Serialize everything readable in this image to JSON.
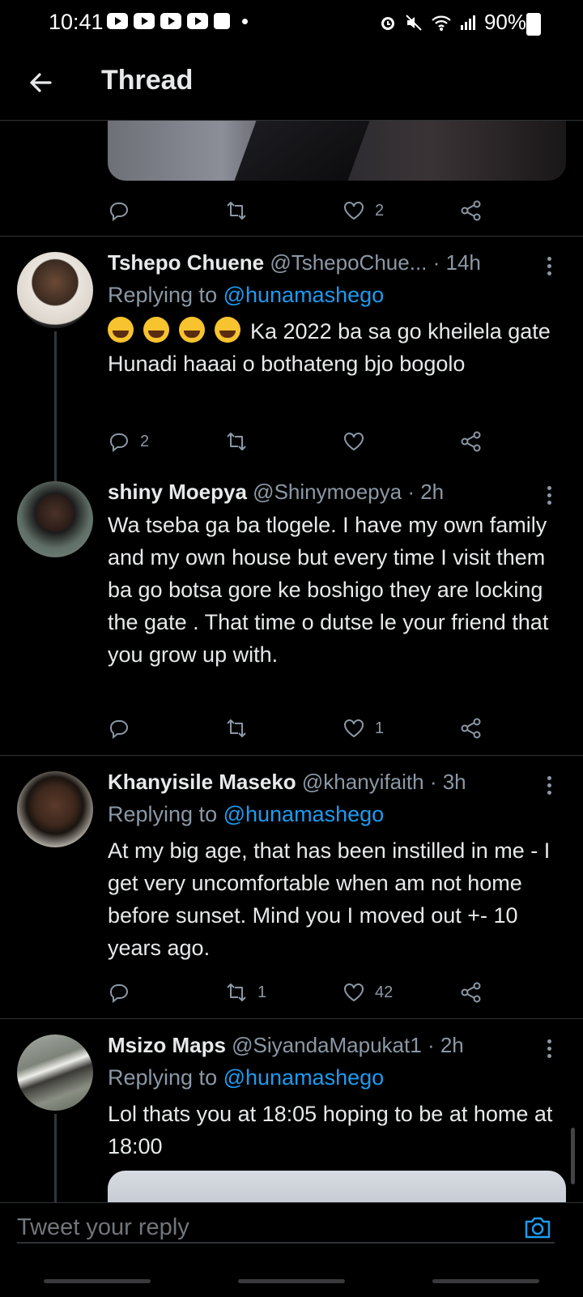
{
  "status_bar": {
    "time": "10:41",
    "battery": "90%"
  },
  "header": {
    "title": "Thread"
  },
  "first_tweet_actions": {
    "likes": "2"
  },
  "tweets": [
    {
      "name": "Tshepo Chuene",
      "handle": "@TshepoChue...",
      "time": "· 14h",
      "replying_prefix": "Replying to ",
      "replying_to": "@hunamashego",
      "emoji_count": 4,
      "text": "Ka 2022 ba sa go kheilela gate Hunadi haaai o bothateng bjo bogolo",
      "replies": "2",
      "retweets": "",
      "likes": ""
    },
    {
      "name": "shiny Moepya",
      "handle": "@Shinymoepya",
      "time": "· 2h",
      "text": "Wa tseba ga ba tlogele. I have my own family and my own house but every time I visit them ba go botsa gore ke boshigo they are locking the gate . That time o dutse le your friend that you grow up with.",
      "replies": "",
      "retweets": "",
      "likes": "1"
    },
    {
      "name": "Khanyisile Maseko",
      "handle": "@khanyifaith",
      "time": "· 3h",
      "replying_prefix": "Replying to ",
      "replying_to": "@hunamashego",
      "text": "At my big age, that has been instilled in me - I get very uncomfortable when am not home before sunset.  Mind you I moved out +- 10 years ago.",
      "replies": "",
      "retweets": "1",
      "likes": "42"
    },
    {
      "name": "Msizo Maps",
      "handle": "@SiyandaMapukat1",
      "time": "· 2h",
      "replying_prefix": "Replying to ",
      "replying_to": "@hunamashego",
      "text": "Lol thats you at 18:05 hoping to  be at home at 18:00"
    }
  ],
  "compose": {
    "placeholder": "Tweet your reply"
  },
  "icons": {
    "reply": "reply-icon",
    "retweet": "retweet-icon",
    "like": "heart-icon",
    "share": "share-icon",
    "back": "back-arrow-icon",
    "camera": "camera-icon",
    "more": "more-vertical-icon"
  },
  "colors": {
    "accent": "#1d9bf0",
    "background": "#000000",
    "text": "#e7e9ea",
    "muted": "#8b98a5"
  }
}
